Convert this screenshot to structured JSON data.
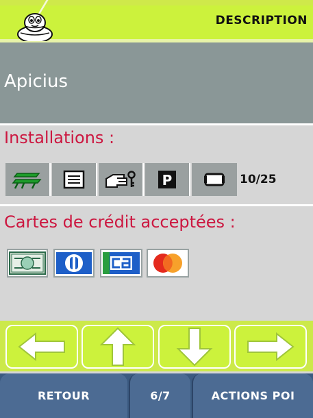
{
  "header": {
    "title": "DESCRIPTION",
    "logo_icon": "michelin-bibendum-icon",
    "accent_color": "#ccf23c"
  },
  "poi": {
    "name": "Apicius"
  },
  "installations": {
    "heading": "Installations :",
    "icons": [
      "garden-terrace-icon",
      "menu-list-icon",
      "valet-hand-key-icon",
      "parking-icon",
      "room-capacity-icon"
    ],
    "count_text": "10/25"
  },
  "cards": {
    "heading": "Cartes de crédit acceptées :",
    "icons": [
      "american-express-icon",
      "diners-club-icon",
      "carte-bleue-icon",
      "mastercard-icon"
    ]
  },
  "nav": {
    "icons": [
      "arrow-left-icon",
      "arrow-up-icon",
      "arrow-down-icon",
      "arrow-right-icon"
    ]
  },
  "bottom": {
    "back_label": "RETOUR",
    "page_label": "6/7",
    "actions_label": "ACTIONS POI",
    "bar_color": "#4c6b93"
  }
}
